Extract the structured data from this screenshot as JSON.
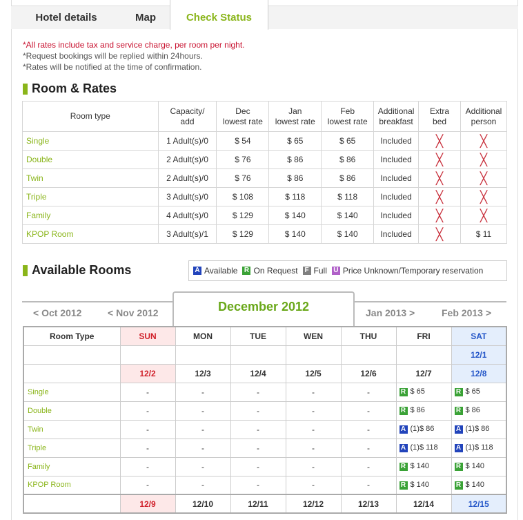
{
  "tabs": {
    "hotel_details": "Hotel details",
    "map": "Map",
    "check_status": "Check Status"
  },
  "notes": {
    "line1": "*All rates include tax and service charge, per room per night.",
    "line2": "*Request bookings will be replied within 24hours.",
    "line3": "*Rates will be notified at the time of confirmation."
  },
  "rates": {
    "title": "Room & Rates",
    "headers": {
      "room_type": "Room type",
      "capacity_1": "Capacity/",
      "capacity_2": "add",
      "dec_1": "Dec",
      "dec_2": "lowest rate",
      "jan_1": "Jan",
      "jan_2": "lowest rate",
      "feb_1": "Feb",
      "feb_2": "lowest rate",
      "breakfast_1": "Additional",
      "breakfast_2": "breakfast",
      "extra_1": "Extra",
      "extra_2": "bed",
      "person_1": "Additional",
      "person_2": "person"
    },
    "rows": [
      {
        "name": "Single",
        "capacity": "1 Adult(s)/0",
        "dec": "$ 54",
        "jan": "$ 65",
        "feb": "$ 65",
        "breakfast": "Included",
        "person": ""
      },
      {
        "name": "Double",
        "capacity": "2 Adult(s)/0",
        "dec": "$ 76",
        "jan": "$ 86",
        "feb": "$ 86",
        "breakfast": "Included",
        "person": ""
      },
      {
        "name": "Twin",
        "capacity": "2 Adult(s)/0",
        "dec": "$ 76",
        "jan": "$ 86",
        "feb": "$ 86",
        "breakfast": "Included",
        "person": ""
      },
      {
        "name": "Triple",
        "capacity": "3 Adult(s)/0",
        "dec": "$ 108",
        "jan": "$ 118",
        "feb": "$ 118",
        "breakfast": "Included",
        "person": ""
      },
      {
        "name": "Family",
        "capacity": "4 Adult(s)/0",
        "dec": "$ 129",
        "jan": "$ 140",
        "feb": "$ 140",
        "breakfast": "Included",
        "person": ""
      },
      {
        "name": "KPOP Room",
        "capacity": "3 Adult(s)/1",
        "dec": "$ 129",
        "jan": "$ 140",
        "feb": "$ 140",
        "breakfast": "Included",
        "person": "$ 11"
      }
    ],
    "x_glyph": "╳"
  },
  "available": {
    "title": "Available Rooms",
    "legend": {
      "a_letter": "A",
      "a_label": "Available",
      "r_letter": "R",
      "r_label": "On Request",
      "f_letter": "F",
      "f_label": "Full",
      "u_letter": "U",
      "u_label": "Price Unknown/Temporary reservation"
    },
    "nav": {
      "prev2": "< Oct 2012",
      "prev1": "< Nov 2012",
      "current": "December 2012",
      "next1": "Jan 2013 >",
      "next2": "Feb 2013 >"
    },
    "calendar": {
      "room_type": "Room Type",
      "days": {
        "sun": "SUN",
        "mon": "MON",
        "tue": "TUE",
        "wen": "WEN",
        "thu": "THU",
        "fri": "FRI",
        "sat": "SAT"
      },
      "week0_sat": "12/1",
      "week1": {
        "sun": "12/2",
        "mon": "12/3",
        "tue": "12/4",
        "wen": "12/5",
        "thu": "12/6",
        "fri": "12/7",
        "sat": "12/8"
      },
      "week2": {
        "sun": "12/9",
        "mon": "12/10",
        "tue": "12/11",
        "wen": "12/12",
        "thu": "12/13",
        "fri": "12/14",
        "sat": "12/15"
      },
      "dash": "-",
      "rows": [
        {
          "name": "Single",
          "fri_badge": "R",
          "fri": "$ 65",
          "sat_badge": "R",
          "sat": "$ 65"
        },
        {
          "name": "Double",
          "fri_badge": "R",
          "fri": "$ 86",
          "sat_badge": "R",
          "sat": "$ 86"
        },
        {
          "name": "Twin",
          "fri_badge": "A",
          "fri": "(1)$ 86",
          "sat_badge": "A",
          "sat": "(1)$ 86"
        },
        {
          "name": "Triple",
          "fri_badge": "A",
          "fri": "(1)$ 118",
          "sat_badge": "A",
          "sat": "(1)$ 118"
        },
        {
          "name": "Family",
          "fri_badge": "R",
          "fri": "$ 140",
          "sat_badge": "R",
          "sat": "$ 140"
        },
        {
          "name": "KPOP Room",
          "fri_badge": "R",
          "fri": "$ 140",
          "sat_badge": "R",
          "sat": "$ 140"
        }
      ]
    }
  },
  "colors": {
    "accent_green": "#8ab51a",
    "required_red": "#c8102e",
    "badge_available": "#2244bb",
    "badge_request": "#3aa236",
    "badge_full": "#808080",
    "badge_unknown": "#b060c8"
  }
}
